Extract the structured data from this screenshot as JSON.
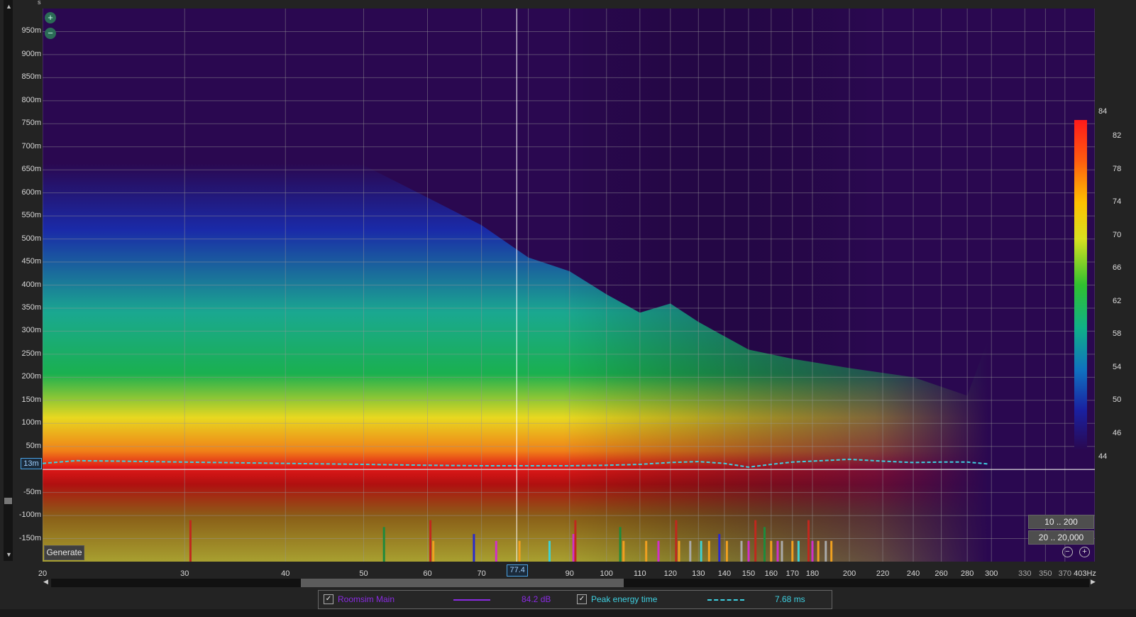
{
  "chart_data": {
    "type": "heatmap",
    "title": "",
    "xlabel": "Hz",
    "ylabel": "",
    "x_scale": "log",
    "xlim": [
      20,
      403
    ],
    "ylim": [
      -0.2,
      1.0
    ],
    "x_ticks": [
      {
        "value": 20,
        "label": "20"
      },
      {
        "value": 30,
        "label": "30"
      },
      {
        "value": 40,
        "label": "40"
      },
      {
        "value": 50,
        "label": "50"
      },
      {
        "value": 60,
        "label": "60"
      },
      {
        "value": 70,
        "label": "70"
      },
      {
        "value": 80,
        "label": "80"
      },
      {
        "value": 90,
        "label": "90"
      },
      {
        "value": 100,
        "label": "100"
      },
      {
        "value": 110,
        "label": "110"
      },
      {
        "value": 120,
        "label": "120"
      },
      {
        "value": 130,
        "label": "130"
      },
      {
        "value": 140,
        "label": "140"
      },
      {
        "value": 150,
        "label": "150"
      },
      {
        "value": 160,
        "label": "160"
      },
      {
        "value": 170,
        "label": "170"
      },
      {
        "value": 180,
        "label": "180"
      },
      {
        "value": 200,
        "label": "200"
      },
      {
        "value": 220,
        "label": "220"
      },
      {
        "value": 240,
        "label": "240"
      },
      {
        "value": 260,
        "label": "260"
      },
      {
        "value": 280,
        "label": "280"
      },
      {
        "value": 300,
        "label": "300"
      },
      {
        "value": 330,
        "label": "330"
      },
      {
        "value": 350,
        "label": "350"
      },
      {
        "value": 370,
        "label": "370"
      },
      {
        "value": 403,
        "label": "403Hz"
      }
    ],
    "y_ticks": [
      {
        "value": 0.95,
        "label": "950m"
      },
      {
        "value": 0.9,
        "label": "900m"
      },
      {
        "value": 0.85,
        "label": "850m"
      },
      {
        "value": 0.8,
        "label": "800m"
      },
      {
        "value": 0.75,
        "label": "750m"
      },
      {
        "value": 0.7,
        "label": "700m"
      },
      {
        "value": 0.65,
        "label": "650m"
      },
      {
        "value": 0.6,
        "label": "600m"
      },
      {
        "value": 0.55,
        "label": "550m"
      },
      {
        "value": 0.5,
        "label": "500m"
      },
      {
        "value": 0.45,
        "label": "450m"
      },
      {
        "value": 0.4,
        "label": "400m"
      },
      {
        "value": 0.35,
        "label": "350m"
      },
      {
        "value": 0.3,
        "label": "300m"
      },
      {
        "value": 0.25,
        "label": "250m"
      },
      {
        "value": 0.2,
        "label": "200m"
      },
      {
        "value": 0.15,
        "label": "150m"
      },
      {
        "value": 0.1,
        "label": "100m"
      },
      {
        "value": 0.05,
        "label": "50m"
      },
      {
        "value": 0,
        "label": "0"
      },
      {
        "value": -0.05,
        "label": "-50m"
      },
      {
        "value": -0.1,
        "label": "-100m"
      },
      {
        "value": -0.15,
        "label": "-150m"
      }
    ],
    "colorbar": {
      "min": 44,
      "max": 84,
      "labels": [
        "84",
        "82",
        "78",
        "74",
        "70",
        "66",
        "62",
        "58",
        "54",
        "50",
        "46",
        "44"
      ]
    },
    "series": [
      {
        "name": "Roomsim Main",
        "kind": "spectrogram",
        "color": "#8a2be2",
        "peak_db": 84.2
      },
      {
        "name": "Peak energy time",
        "kind": "line",
        "color": "#3fd0e0",
        "dashed": true,
        "x": [
          20,
          22,
          25,
          30,
          40,
          50,
          60,
          70,
          80,
          90,
          100,
          110,
          120,
          130,
          140,
          150,
          160,
          170,
          180,
          200,
          220,
          240,
          260,
          280,
          297
        ],
        "y": [
          0.013,
          0.019,
          0.018,
          0.016,
          0.013,
          0.011,
          0.009,
          0.008,
          0.008,
          0.008,
          0.009,
          0.011,
          0.015,
          0.017,
          0.013,
          0.005,
          0.011,
          0.016,
          0.018,
          0.022,
          0.018,
          0.015,
          0.016,
          0.016,
          0.012
        ]
      }
    ],
    "marker_lines": [
      {
        "x": 30.5,
        "color": "#c0281e",
        "top": -0.11
      },
      {
        "x": 53,
        "color": "#1e8a3c",
        "top": -0.125
      },
      {
        "x": 60.5,
        "color": "#c0281e",
        "top": -0.11
      },
      {
        "x": 61,
        "color": "#f0a020",
        "top": -0.155
      },
      {
        "x": 68.5,
        "color": "#2a2acc",
        "top": -0.14
      },
      {
        "x": 73,
        "color": "#d030c8",
        "top": -0.155
      },
      {
        "x": 78,
        "color": "#f0a020",
        "top": -0.155
      },
      {
        "x": 85,
        "color": "#40d0d0",
        "top": -0.155
      },
      {
        "x": 91,
        "color": "#d030c8",
        "top": -0.14
      },
      {
        "x": 91.5,
        "color": "#c0281e",
        "top": -0.11
      },
      {
        "x": 104,
        "color": "#1e8a3c",
        "top": -0.125
      },
      {
        "x": 105,
        "color": "#f0a020",
        "top": -0.155
      },
      {
        "x": 112,
        "color": "#f0a020",
        "top": -0.155
      },
      {
        "x": 116,
        "color": "#d030c8",
        "top": -0.155
      },
      {
        "x": 122,
        "color": "#c0281e",
        "top": -0.11
      },
      {
        "x": 123,
        "color": "#f0a020",
        "top": -0.155
      },
      {
        "x": 127,
        "color": "#aaaaaa",
        "top": -0.155
      },
      {
        "x": 131,
        "color": "#40d0d0",
        "top": -0.155
      },
      {
        "x": 134,
        "color": "#f0a020",
        "top": -0.155
      },
      {
        "x": 138,
        "color": "#2a2acc",
        "top": -0.14
      },
      {
        "x": 141,
        "color": "#f0a020",
        "top": -0.155
      },
      {
        "x": 147,
        "color": "#aaaaaa",
        "top": -0.155
      },
      {
        "x": 150,
        "color": "#d030c8",
        "top": -0.155
      },
      {
        "x": 153,
        "color": "#c0281e",
        "top": -0.11
      },
      {
        "x": 157,
        "color": "#1e8a3c",
        "top": -0.125
      },
      {
        "x": 160,
        "color": "#f0a020",
        "top": -0.155
      },
      {
        "x": 163,
        "color": "#d030c8",
        "top": -0.155
      },
      {
        "x": 165,
        "color": "#aaaaaa",
        "top": -0.155
      },
      {
        "x": 170,
        "color": "#f0a020",
        "top": -0.155
      },
      {
        "x": 173,
        "color": "#40d0d0",
        "top": -0.155
      },
      {
        "x": 178,
        "color": "#c0281e",
        "top": -0.11
      },
      {
        "x": 180,
        "color": "#d030c8",
        "top": -0.155
      },
      {
        "x": 183,
        "color": "#f0a020",
        "top": -0.155
      },
      {
        "x": 187,
        "color": "#aaaaaa",
        "top": -0.155
      },
      {
        "x": 190,
        "color": "#f0a020",
        "top": -0.155
      }
    ],
    "cursor_x": 77.4,
    "cursor_label": "77.4",
    "time_marker": {
      "value": 0.013,
      "label": "13m"
    },
    "grid": true,
    "legend_position": "bottom"
  },
  "ui": {
    "generate_label": "Generate",
    "range_buttons": [
      "10 .. 200",
      "20 .. 20,000"
    ],
    "legend": [
      {
        "label": "Roomsim Main",
        "value": "84.2 dB",
        "color": "#8a2be2",
        "checked": true
      },
      {
        "label": "Peak energy time",
        "value": "7.68 ms",
        "color": "#3fd0e0",
        "checked": true
      }
    ],
    "check_mark": "✓",
    "zoom_in_glyph": "+",
    "zoom_out_glyph": "−"
  }
}
